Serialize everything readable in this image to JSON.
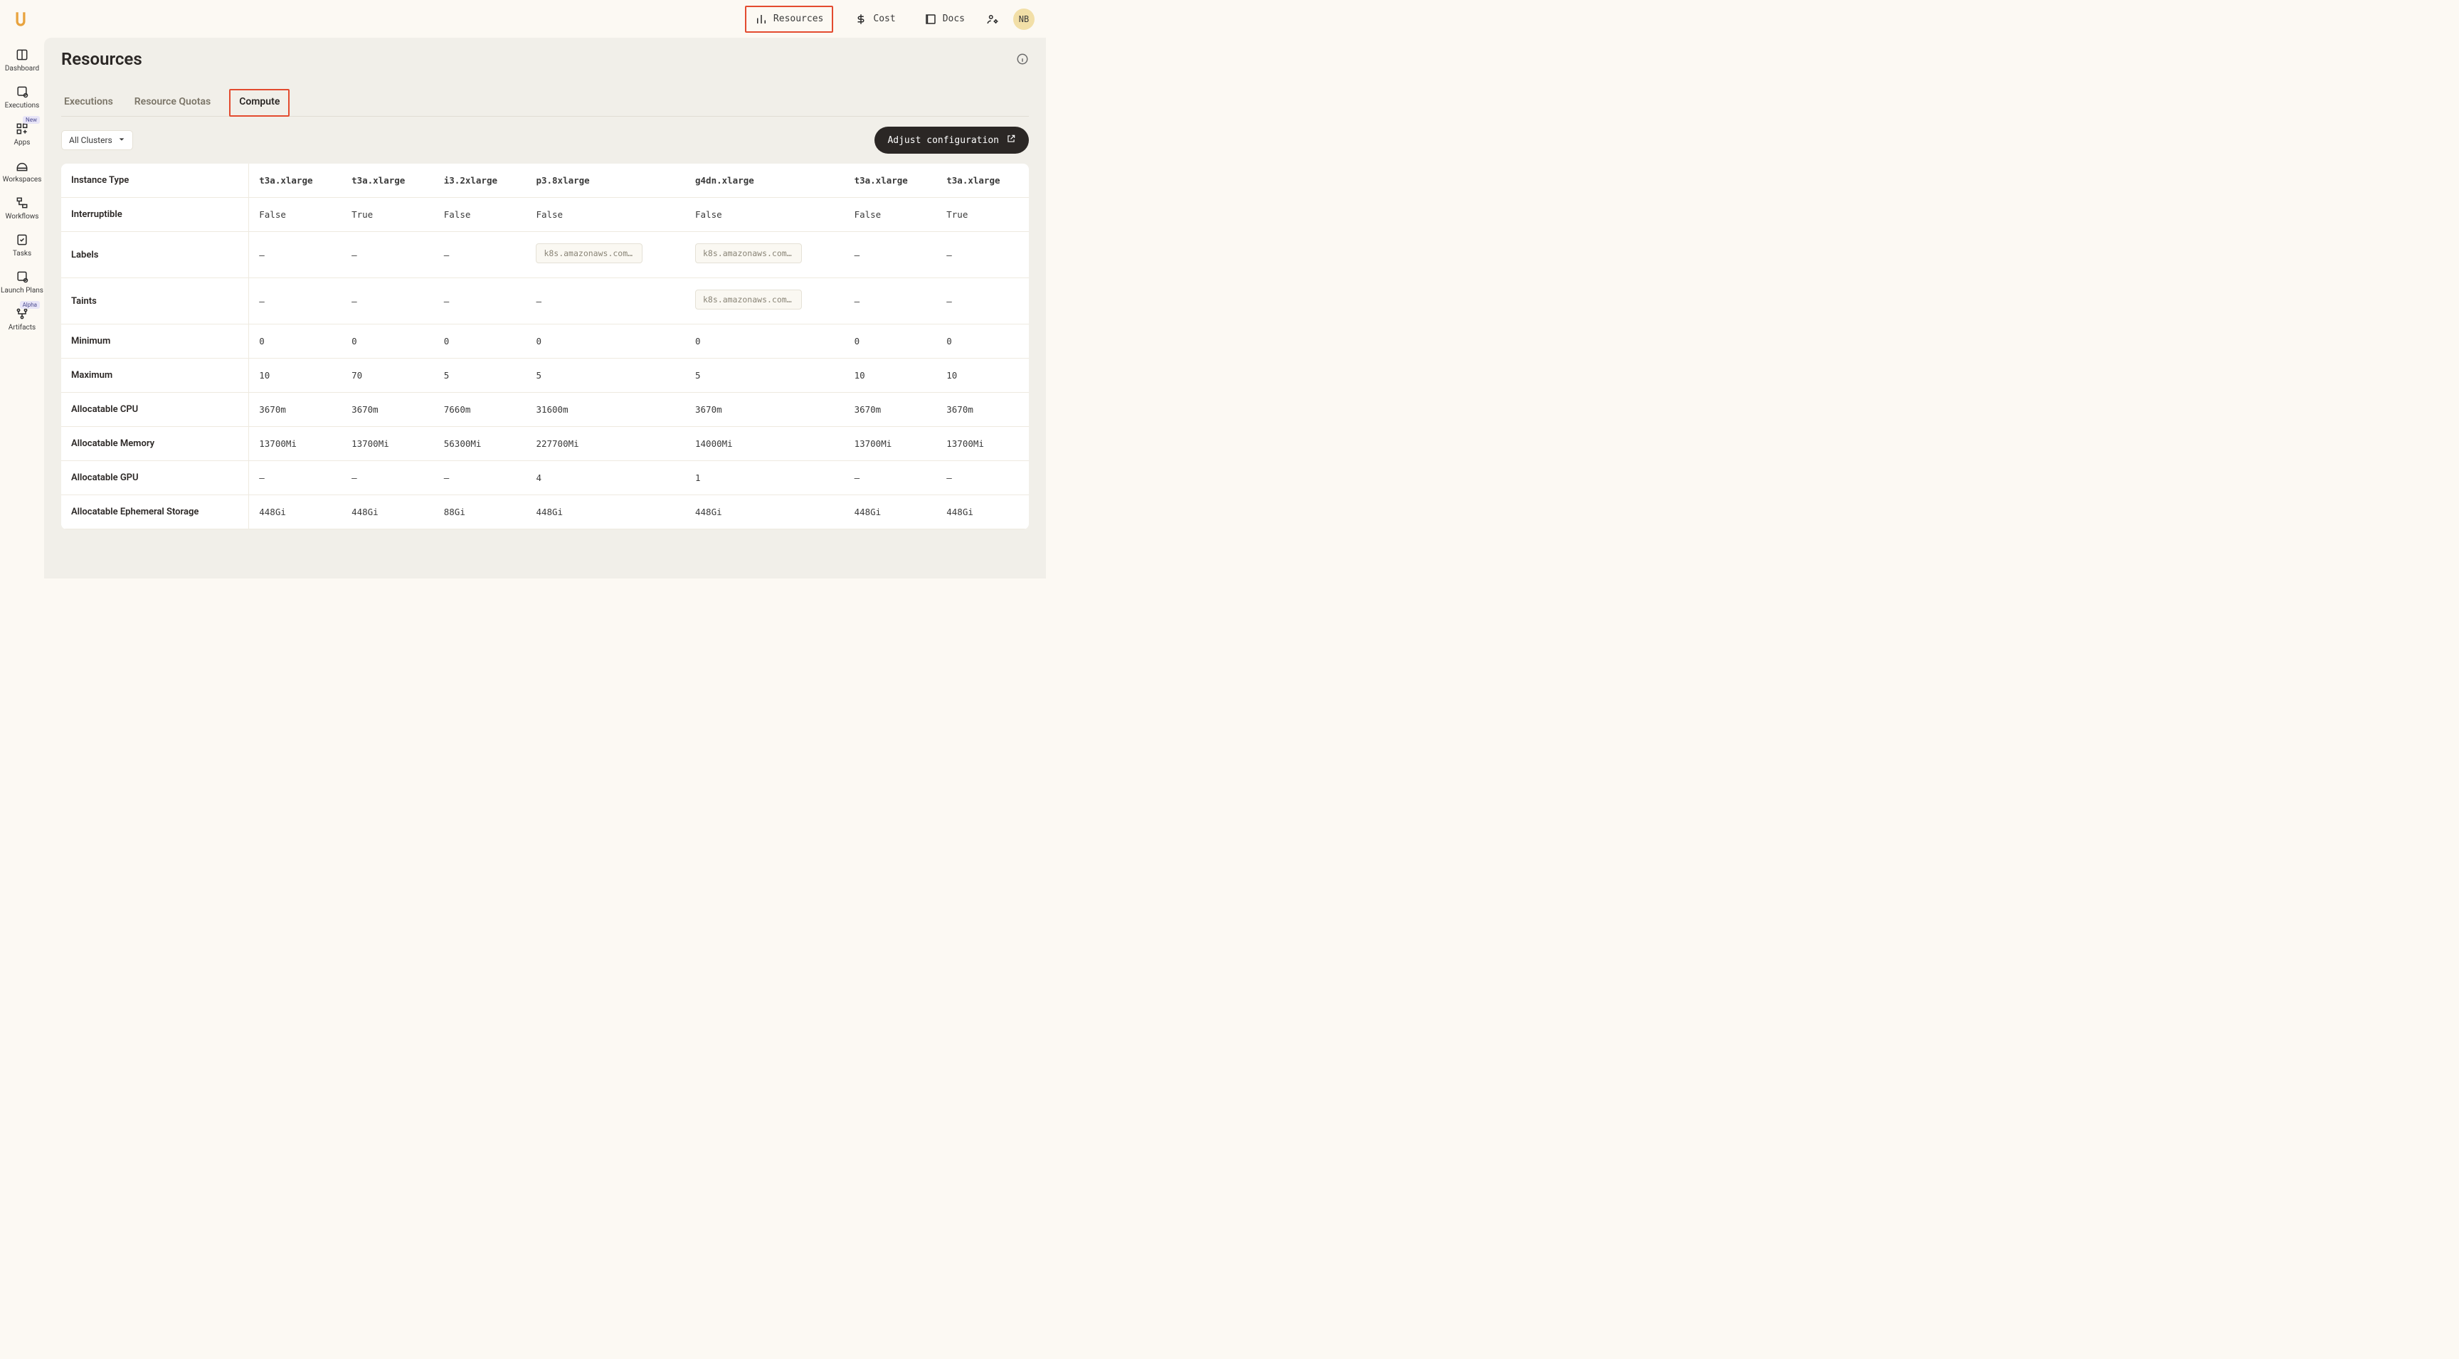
{
  "topnav": {
    "resources": "Resources",
    "cost": "Cost",
    "docs": "Docs"
  },
  "avatar": "NB",
  "sidebar": {
    "dashboard": "Dashboard",
    "executions": "Executions",
    "apps": "Apps",
    "apps_badge": "New",
    "workspaces": "Workspaces",
    "workflows": "Workflows",
    "tasks": "Tasks",
    "launch_plans": "Launch Plans",
    "artifacts": "Artifacts",
    "artifacts_badge": "Alpha"
  },
  "page": {
    "title": "Resources"
  },
  "tabs": {
    "executions": "Executions",
    "quotas": "Resource Quotas",
    "compute": "Compute"
  },
  "controls": {
    "cluster_filter": "All Clusters",
    "adjust": "Adjust configuration"
  },
  "row_headers": {
    "instance_type": "Instance Type",
    "interruptible": "Interruptible",
    "labels": "Labels",
    "taints": "Taints",
    "minimum": "Minimum",
    "maximum": "Maximum",
    "cpu": "Allocatable CPU",
    "memory": "Allocatable Memory",
    "gpu": "Allocatable GPU",
    "storage": "Allocatable Ephemeral Storage"
  },
  "columns": [
    {
      "instance_type": "t3a.xlarge",
      "interruptible": "False",
      "labels": "—",
      "taints": "—",
      "minimum": "0",
      "maximum": "10",
      "cpu": "3670m",
      "memory": "13700Mi",
      "gpu": "—",
      "storage": "448Gi"
    },
    {
      "instance_type": "t3a.xlarge",
      "interruptible": "True",
      "labels": "—",
      "taints": "—",
      "minimum": "0",
      "maximum": "70",
      "cpu": "3670m",
      "memory": "13700Mi",
      "gpu": "—",
      "storage": "448Gi"
    },
    {
      "instance_type": "i3.2xlarge",
      "interruptible": "False",
      "labels": "—",
      "taints": "—",
      "minimum": "0",
      "maximum": "5",
      "cpu": "7660m",
      "memory": "56300Mi",
      "gpu": "—",
      "storage": "88Gi"
    },
    {
      "instance_type": "p3.8xlarge",
      "interruptible": "False",
      "labels": "k8s.amazonaws.com/a…",
      "labels_chip": true,
      "taints": "—",
      "minimum": "0",
      "maximum": "5",
      "cpu": "31600m",
      "memory": "227700Mi",
      "gpu": "4",
      "storage": "448Gi"
    },
    {
      "instance_type": "g4dn.xlarge",
      "interruptible": "False",
      "labels": "k8s.amazonaws.com/a…",
      "labels_chip": true,
      "taints": "k8s.amazonaws.com/a…",
      "taints_chip": true,
      "minimum": "0",
      "maximum": "5",
      "cpu": "3670m",
      "memory": "14000Mi",
      "gpu": "1",
      "storage": "448Gi"
    },
    {
      "instance_type": "t3a.xlarge",
      "interruptible": "False",
      "labels": "—",
      "taints": "—",
      "minimum": "0",
      "maximum": "10",
      "cpu": "3670m",
      "memory": "13700Mi",
      "gpu": "—",
      "storage": "448Gi"
    },
    {
      "instance_type": "t3a.xlarge",
      "interruptible": "True",
      "labels": "—",
      "taints": "—",
      "minimum": "0",
      "maximum": "10",
      "cpu": "3670m",
      "memory": "13700Mi",
      "gpu": "—",
      "storage": "448Gi"
    }
  ]
}
